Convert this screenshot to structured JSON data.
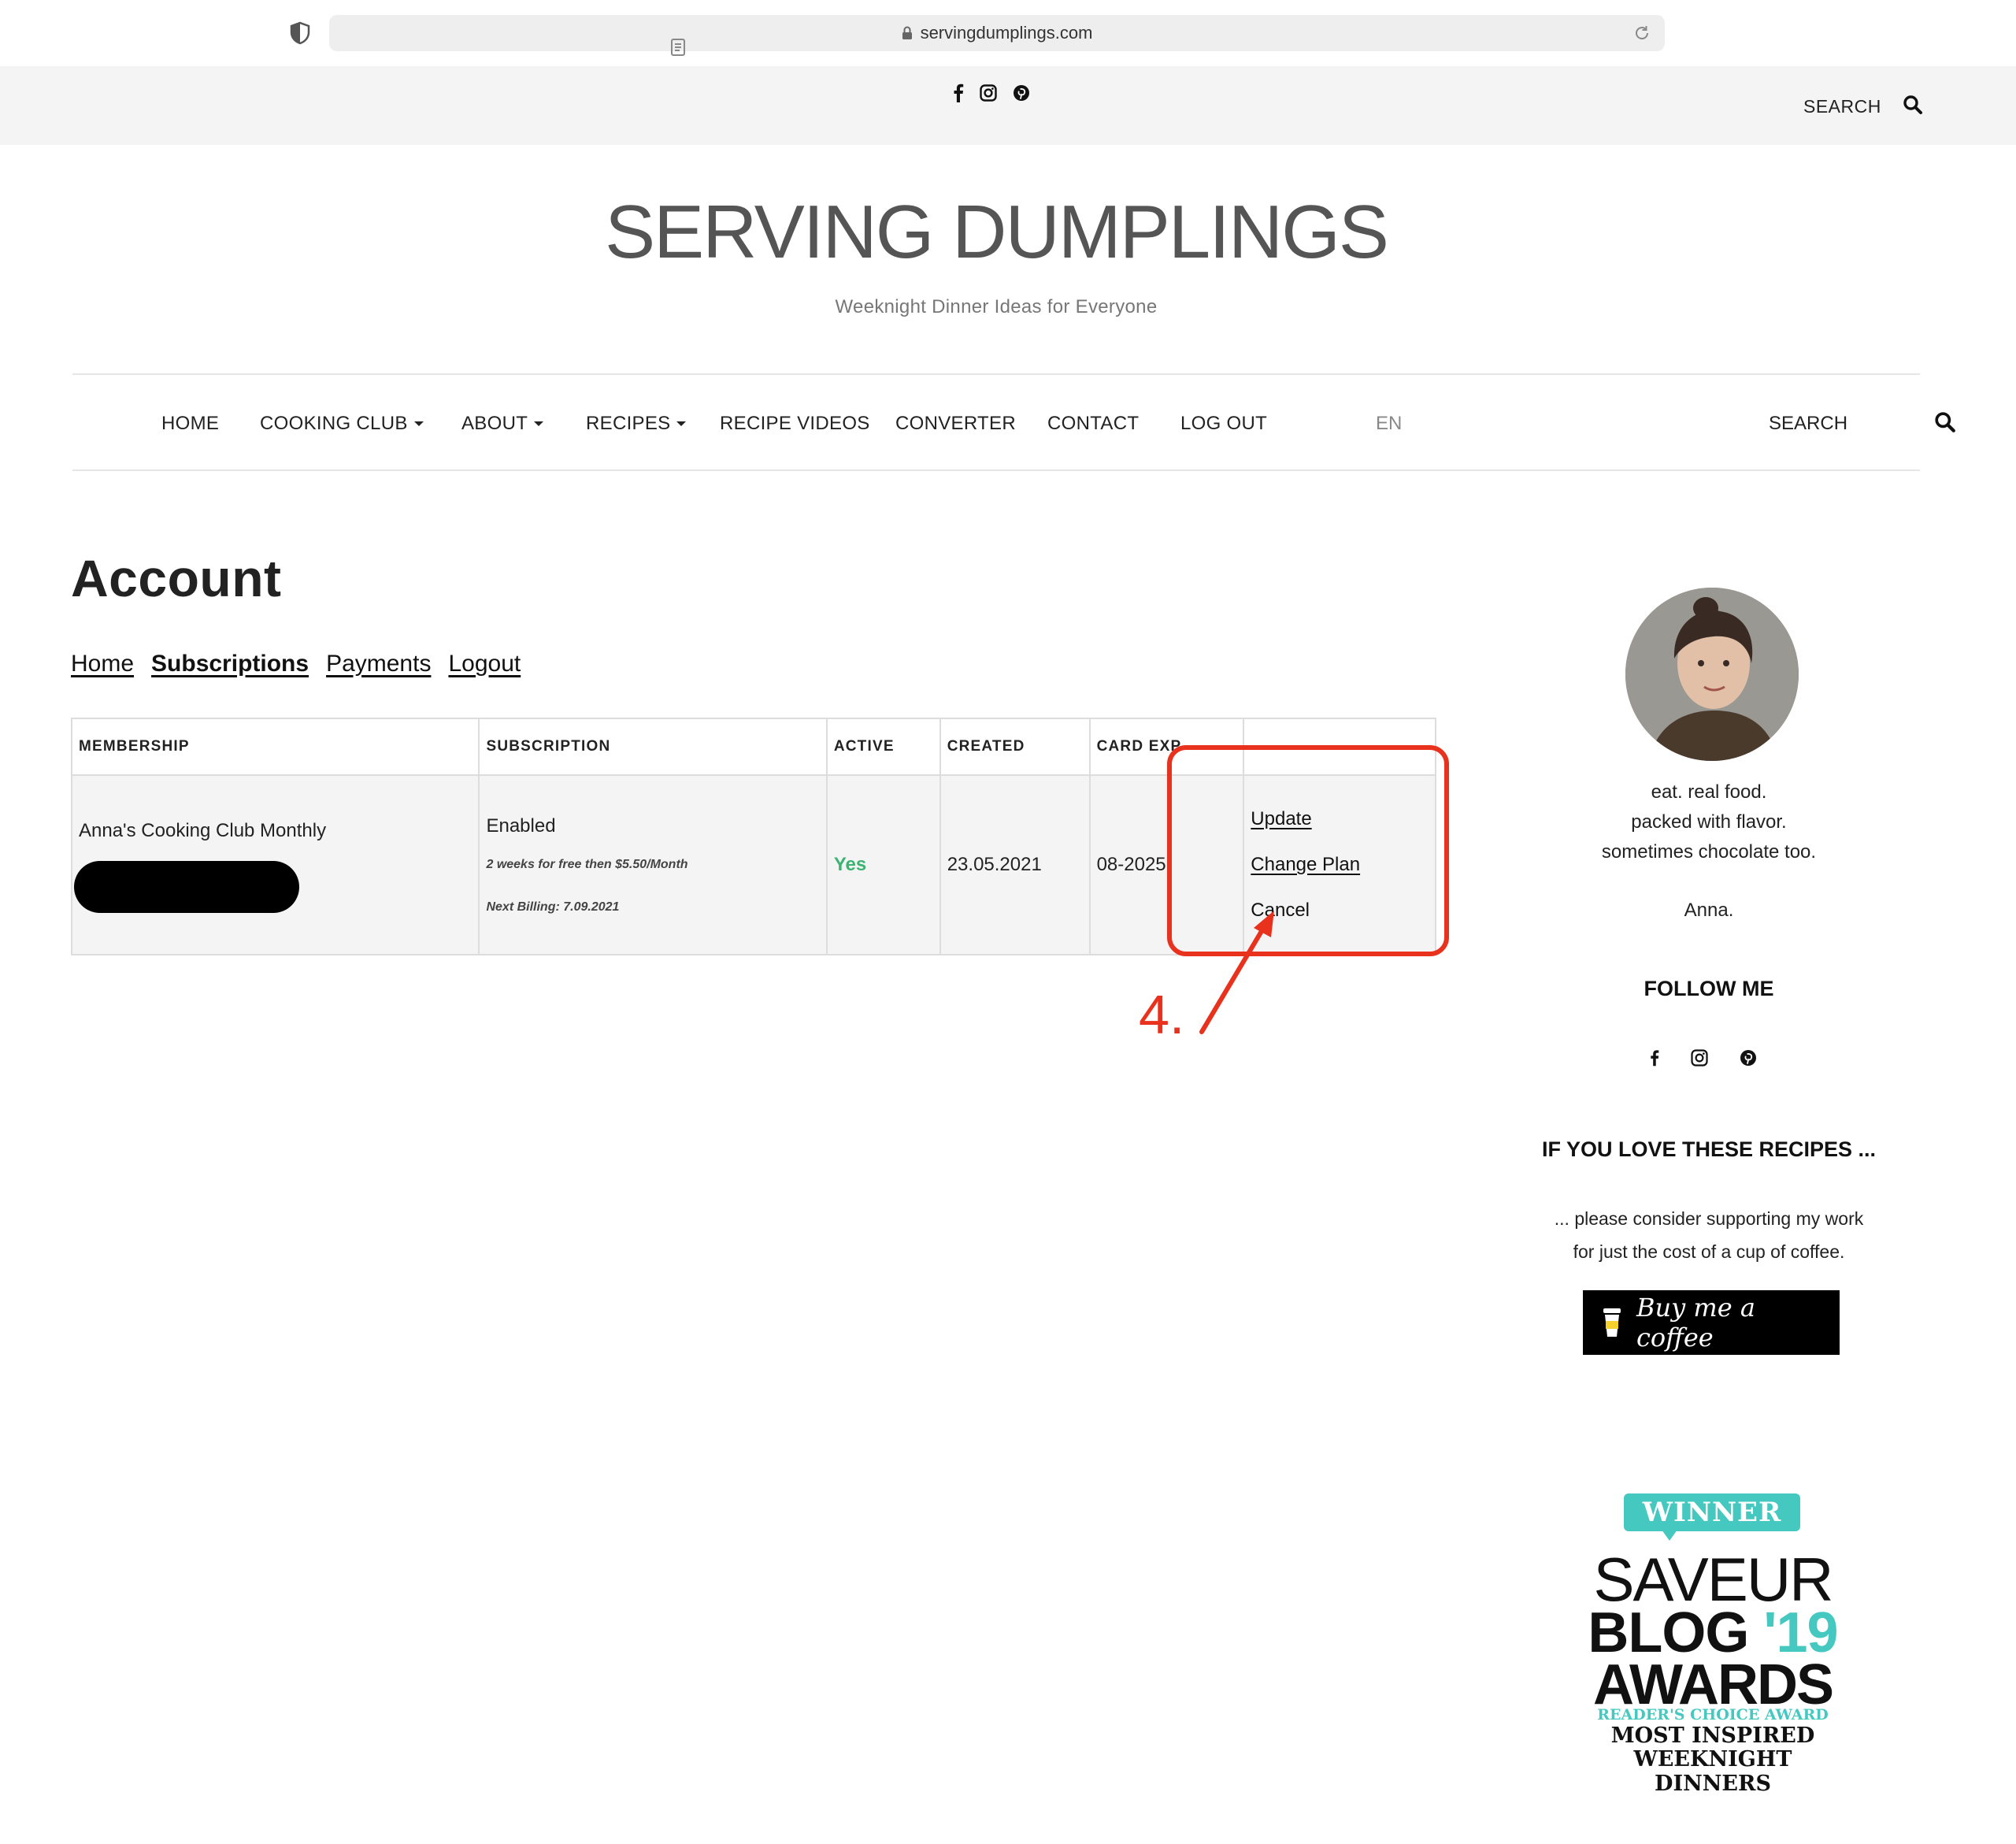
{
  "browser": {
    "url": "servingdumplings.com",
    "icons": [
      "shield-icon",
      "reader-icon",
      "lock-icon",
      "reload-icon"
    ]
  },
  "topbar": {
    "social_icons": [
      "facebook-icon",
      "instagram-icon",
      "pinterest-icon"
    ],
    "search_label": "SEARCH"
  },
  "site": {
    "title": "SERVING DUMPLINGS",
    "tagline": "Weeknight Dinner Ideas for Everyone"
  },
  "nav": {
    "items": [
      {
        "label": "HOME",
        "has_dropdown": false
      },
      {
        "label": "COOKING CLUB",
        "has_dropdown": true
      },
      {
        "label": "ABOUT",
        "has_dropdown": true
      },
      {
        "label": "RECIPES",
        "has_dropdown": true
      },
      {
        "label": "RECIPE VIDEOS",
        "has_dropdown": false
      },
      {
        "label": "CONVERTER",
        "has_dropdown": false
      },
      {
        "label": "CONTACT",
        "has_dropdown": false
      },
      {
        "label": "LOG OUT",
        "has_dropdown": false
      }
    ],
    "language": "EN",
    "search_label": "SEARCH"
  },
  "account": {
    "title": "Account",
    "tabs": [
      {
        "label": "Home",
        "active": false
      },
      {
        "label": "Subscriptions",
        "active": true
      },
      {
        "label": "Payments",
        "active": false
      },
      {
        "label": "Logout",
        "active": false
      }
    ],
    "table": {
      "headers": [
        "MEMBERSHIP",
        "SUBSCRIPTION",
        "ACTIVE",
        "CREATED",
        "CARD EXP",
        ""
      ],
      "rows": [
        {
          "membership": "Anna's Cooking Club Monthly",
          "subscription_status": "Enabled",
          "subscription_terms": "2 weeks for free then $5.50/Month",
          "next_billing": "Next Billing: 7.09.2021",
          "active": "Yes",
          "created": "23.05.2021",
          "card_exp": "08-2025",
          "actions": {
            "update": "Update",
            "change_plan": "Change Plan",
            "cancel": "Cancel"
          }
        }
      ]
    }
  },
  "annotation": {
    "label": "4.",
    "color": "#e8321e"
  },
  "sidebar": {
    "bio_lines": [
      "eat. real food.",
      "packed with flavor.",
      "sometimes chocolate too.",
      "Anna."
    ],
    "follow_heading": "FOLLOW ME",
    "follow_icons": [
      "facebook-icon",
      "instagram-icon",
      "pinterest-icon"
    ],
    "support_heading": "IF YOU LOVE THESE RECIPES ...",
    "support_text_1": "... please consider supporting my work",
    "support_text_2": "for just the cost of a cup of coffee.",
    "coffee_button": "Buy me a coffee"
  },
  "award": {
    "winner": "WINNER",
    "saveur": "SAVEUR",
    "blog": "BLOG",
    "year": "'19",
    "awards": "AWARDS",
    "readers_choice": "READER'S CHOICE AWARD",
    "line1": "MOST INSPIRED",
    "line2": "WEEKNIGHT DINNERS",
    "accent_color": "#44c8c0"
  },
  "colors": {
    "active_green": "#3cb371",
    "topbar_bg": "#f4f4f4"
  }
}
